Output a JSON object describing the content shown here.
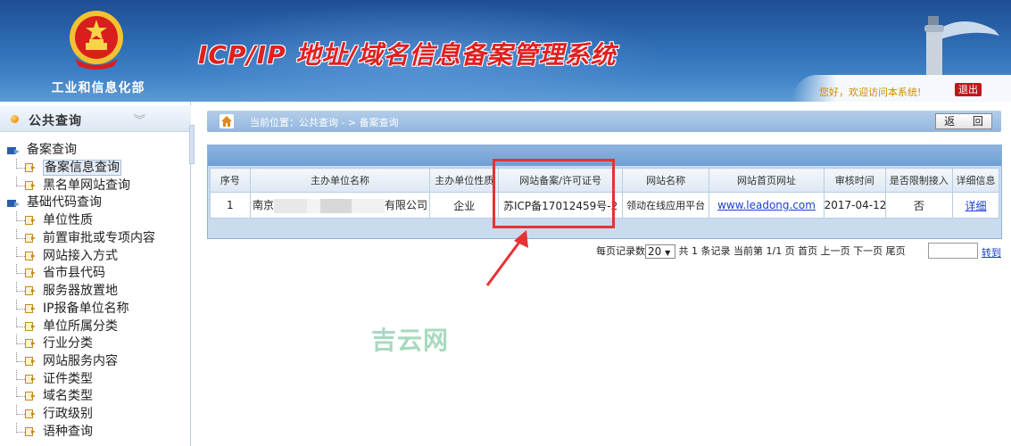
{
  "header": {
    "ministry": "工业和信息化部",
    "system_title": "ICP/IP 地址/域名信息备案管理系统",
    "welcome": "您好，欢迎访问本系统!",
    "logout": "退出",
    "accent": "#e02020"
  },
  "sidebar": {
    "title": "公共查询",
    "collapse_icon": "double-chevron-down-icon",
    "groups": [
      {
        "label": "备案查询",
        "items": [
          {
            "label": "备案信息查询",
            "active": true
          },
          {
            "label": "黑名单网站查询",
            "active": false
          }
        ]
      },
      {
        "label": "基础代码查询",
        "items": [
          {
            "label": "单位性质"
          },
          {
            "label": "前置审批或专项内容"
          },
          {
            "label": "网站接入方式"
          },
          {
            "label": "省市县代码"
          },
          {
            "label": "服务器放置地"
          },
          {
            "label": "IP报备单位名称"
          },
          {
            "label": "单位所属分类"
          },
          {
            "label": "行业分类"
          },
          {
            "label": "网站服务内容"
          },
          {
            "label": "证件类型"
          },
          {
            "label": "域名类型"
          },
          {
            "label": "行政级别"
          },
          {
            "label": "语种查询"
          }
        ]
      }
    ]
  },
  "breadcrumb": {
    "text": "当前位置：公共查询 - > 备案查询",
    "back": "返 回"
  },
  "table": {
    "columns": [
      "序号",
      "主办单位名称",
      "主办单位性质",
      "网站备案/许可证号",
      "网站名称",
      "网站首页网址",
      "审核时间",
      "是否限制接入",
      "详细信息"
    ],
    "rows": [
      {
        "index": "1",
        "org_prefix": "南京",
        "org_suffix": "有限公司",
        "org_type": "企业",
        "license": "苏ICP备17012459号-2",
        "site_name": "领动在线应用平台",
        "url": "www.leadong.com",
        "date": "2017-04-12",
        "restricted": "否",
        "detail": "详细"
      }
    ]
  },
  "pager": {
    "per_page_label": "每页记录数",
    "per_page": "20",
    "summary": "共 1 条记录  当前第 1/1 页 首页 上一页 下一页 尾页",
    "go": "转到"
  },
  "watermark": "吉云网"
}
